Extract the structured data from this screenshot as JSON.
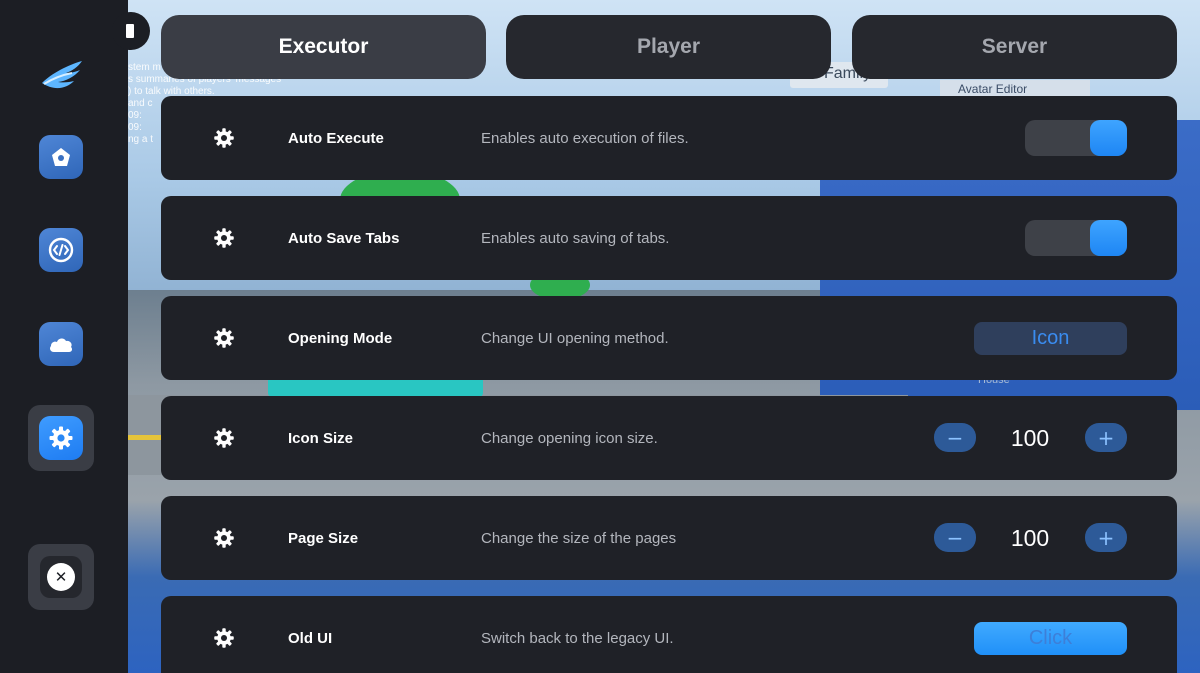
{
  "background": {
    "chat_lines": [
      "stem m",
      "s summaries of players' messages",
      ") to talk with others.",
      "and c",
      "09:",
      "09:",
      "ng a t"
    ],
    "sign_family": "Family",
    "sign_avatar_editor": "Avatar Editor",
    "sign_house": "House"
  },
  "sidebar": {
    "items": [
      {
        "name": "home",
        "icon": "home-icon"
      },
      {
        "name": "code",
        "icon": "code-icon"
      },
      {
        "name": "cloud",
        "icon": "cloud-icon"
      },
      {
        "name": "settings",
        "icon": "gear-icon",
        "active": true
      }
    ],
    "close_symbol": "✕"
  },
  "tabs": [
    {
      "label": "Executor",
      "active": true
    },
    {
      "label": "Player",
      "active": false
    },
    {
      "label": "Server",
      "active": false
    }
  ],
  "settings": [
    {
      "title": "Auto Execute",
      "description": "Enables auto execution of files.",
      "control": "toggle",
      "value": true
    },
    {
      "title": "Auto Save Tabs",
      "description": "Enables auto saving of tabs.",
      "control": "toggle",
      "value": true
    },
    {
      "title": "Opening Mode",
      "description": "Change UI opening method.",
      "control": "button",
      "button_label": "Icon"
    },
    {
      "title": "Icon Size",
      "description": "Change opening icon size.",
      "control": "stepper",
      "value": "100",
      "minus": "−",
      "plus": "+"
    },
    {
      "title": "Page Size",
      "description": "Change the size of the pages",
      "control": "stepper",
      "value": "100",
      "minus": "−",
      "plus": "+"
    },
    {
      "title": "Old UI",
      "description": "Switch back to the legacy UI.",
      "control": "button",
      "button_label": "Click"
    }
  ],
  "colors": {
    "accent": "#2090f8",
    "panel": "#1f2127",
    "sidebar": "#1c1e24"
  }
}
